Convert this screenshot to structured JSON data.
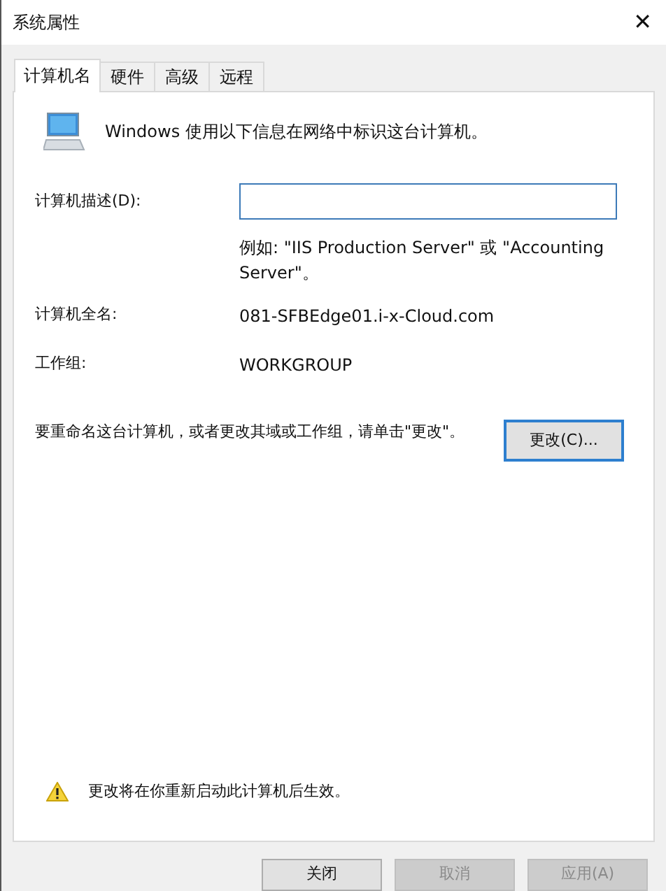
{
  "window": {
    "title": "系统属性",
    "close": "✕"
  },
  "tabs": [
    {
      "label": "计算机名",
      "selected": true
    },
    {
      "label": "硬件",
      "selected": false
    },
    {
      "label": "高级",
      "selected": false
    },
    {
      "label": "远程",
      "selected": false
    }
  ],
  "intro": "Windows 使用以下信息在网络中标识这台计算机。",
  "description": {
    "label": "计算机描述(D):",
    "hint": "例如: \"IIS Production Server\" 或 \"Accounting Server\"。"
  },
  "full_name": {
    "label": "计算机全名:",
    "value": "081-SFBEdge01.i-x-Cloud.com"
  },
  "workgroup": {
    "label": "工作组:",
    "value": "WORKGROUP"
  },
  "rename": {
    "text": "要重命名这台计算机，或者更改其域或工作组，请单击\"更改\"。",
    "button": "更改(C)..."
  },
  "warning": "更改将在你重新启动此计算机后生效。",
  "buttons": [
    {
      "label": "关闭",
      "disabled": false
    },
    {
      "label": "取消",
      "disabled": true
    },
    {
      "label": "应用(A)",
      "disabled": true
    }
  ]
}
